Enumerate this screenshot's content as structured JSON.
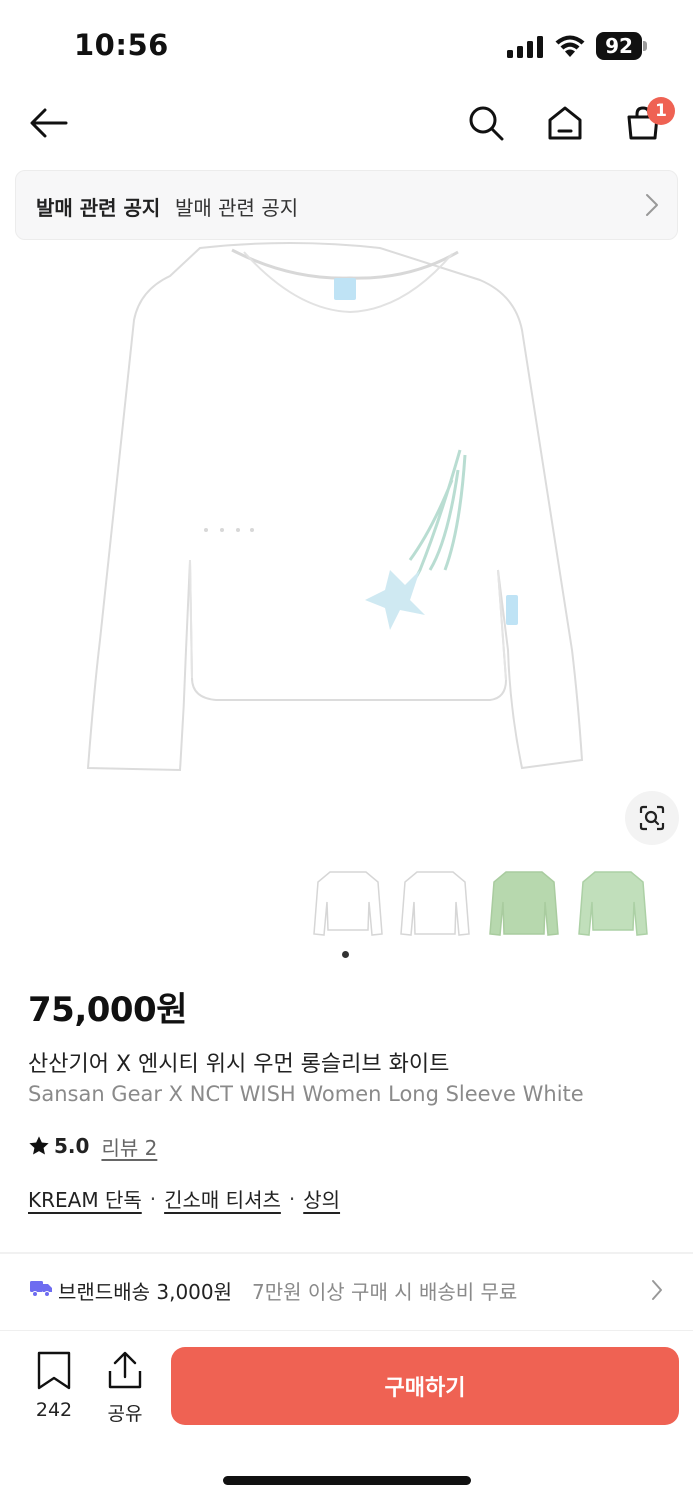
{
  "status_bar": {
    "time": "10:56",
    "battery": "92"
  },
  "nav": {
    "cart_badge": "1"
  },
  "notice": {
    "bold_text": "발매 관련 공지",
    "text": "발매 관련 공지"
  },
  "product": {
    "price": "75,000원",
    "name_ko": "산산기어 X 엔시티 위시 우먼 롱슬리브 화이트",
    "name_en": "Sansan Gear X NCT WISH Women Long Sleeve White",
    "rating": "5.0",
    "review_link": "리뷰 2",
    "tags": [
      "KREAM 단독",
      "긴소매 티셔츠",
      "상의"
    ],
    "tag_separator": "·",
    "thumbnail_colors": [
      "#ffffff",
      "#ffffff",
      "#b7d8ae",
      "#c1dfbb"
    ]
  },
  "shipping": {
    "label": "브랜드배송 3,000원",
    "note": "7만원 이상 구매 시 배송비 무료"
  },
  "bottom_bar": {
    "bookmark_count": "242",
    "share_label": "공유",
    "buy_label": "구매하기"
  },
  "colors": {
    "accent": "#ef6253",
    "shipping_icon": "#6e6cf0"
  },
  "icons": [
    "back-arrow-icon",
    "search-icon",
    "home-icon",
    "shopping-bag-icon",
    "chevron-right-icon",
    "lens-search-icon",
    "star-icon",
    "truck-icon",
    "bookmark-icon",
    "share-icon"
  ]
}
